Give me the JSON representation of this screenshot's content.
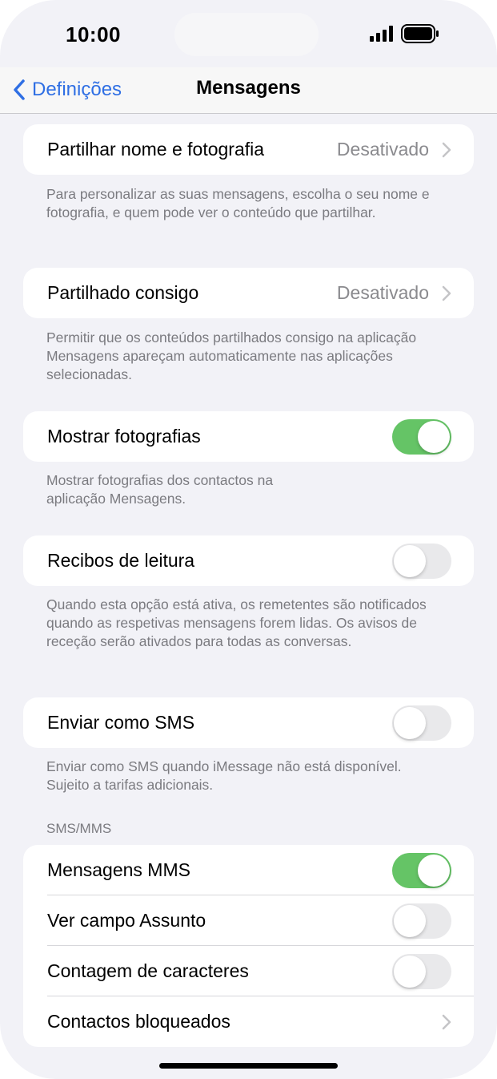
{
  "status_bar": {
    "time": "10:00"
  },
  "nav": {
    "back_label": "Definições",
    "title": "Mensagens"
  },
  "rows": {
    "share_name": {
      "label": "Partilhar nome e fotografia",
      "value": "Desativado",
      "footer": "Para personalizar as suas mensagens, escolha o seu nome e fotografia, e quem pode ver o conteúdo que partilhar."
    },
    "shared_with_you": {
      "label": "Partilhado consigo",
      "value": "Desativado",
      "footer": "Permitir que os conteúdos partilhados consigo na aplicação Mensagens apareçam automaticamente nas aplicações selecionadas."
    },
    "show_photos": {
      "label": "Mostrar fotografias",
      "enabled": true,
      "footer": "Mostrar fotografias dos contactos na aplicação Mensagens."
    },
    "read_receipts": {
      "label": "Recibos de leitura",
      "enabled": false,
      "footer": "Quando esta opção está ativa, os remetentes são notificados quando as respetivas mensagens forem lidas. Os avisos de receção serão ativados para todas as conversas."
    },
    "send_as_sms": {
      "label": "Enviar como SMS",
      "enabled": false,
      "footer": "Enviar como SMS quando iMessage não está disponível. Sujeito a tarifas adicionais."
    }
  },
  "sms_mms": {
    "header": "SMS/MMS",
    "mms": {
      "label": "Mensagens MMS",
      "enabled": true
    },
    "subject": {
      "label": "Ver campo Assunto",
      "enabled": false
    },
    "char_count": {
      "label": "Contagem de caracteres",
      "enabled": false
    },
    "blocked": {
      "label": "Contactos bloqueados"
    }
  },
  "colors": {
    "accent": "#2f6fe4",
    "toggle_on": "#65c466",
    "toggle_off": "#e9e9eb",
    "background": "#f2f2f7"
  }
}
